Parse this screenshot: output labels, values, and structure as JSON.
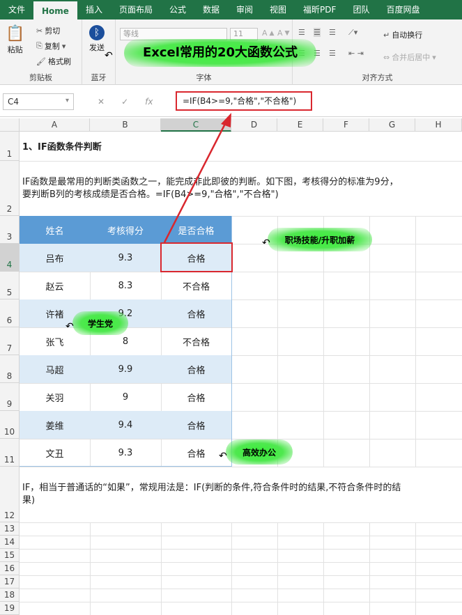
{
  "tabs": [
    "文件",
    "Home",
    "插入",
    "页面布局",
    "公式",
    "数据",
    "审阅",
    "视图",
    "福昕PDF",
    "团队",
    "百度网盘"
  ],
  "ribbon": {
    "paste": "粘贴",
    "cut": "剪切",
    "copy": "复制",
    "format_painter": "格式刷",
    "clipboard_label": "剪贴板",
    "send": "发送",
    "bluetooth_label": "蓝牙",
    "font_name": "等线",
    "font_size": "11",
    "font_label": "字体",
    "wrap": "自动换行",
    "merge": "合并后居中",
    "align_label": "对齐方式"
  },
  "banner": "Excel常用的20大函数公式",
  "formula_bar": {
    "name_box": "C4",
    "formula": "=IF(B4>=9,\"合格\",\"不合格\")"
  },
  "columns": [
    "A",
    "B",
    "C",
    "D",
    "E",
    "F",
    "G",
    "H"
  ],
  "rows": [
    "1",
    "2",
    "3",
    "4",
    "5",
    "6",
    "7",
    "8",
    "9",
    "10",
    "11",
    "12",
    "13",
    "14",
    "15",
    "16",
    "17",
    "18",
    "19"
  ],
  "sheet": {
    "title": "1、IF函数条件判断",
    "desc_line1": "IF函数是最常用的判断类函数之一，能完成非此即彼的判断。如下图，考核得分的标准为9分，",
    "desc_line2": "要判断B列的考核成绩是否合格。=IF(B4>=9,\"合格\",\"不合格\")",
    "table_headers": [
      "姓名",
      "考核得分",
      "是否合格"
    ],
    "table_rows": [
      [
        "吕布",
        "9.3",
        "合格"
      ],
      [
        "赵云",
        "8.3",
        "不合格"
      ],
      [
        "许褚",
        "9.2",
        "合格"
      ],
      [
        "张飞",
        "8",
        "不合格"
      ],
      [
        "马超",
        "9.9",
        "合格"
      ],
      [
        "关羽",
        "9",
        "合格"
      ],
      [
        "姜维",
        "9.4",
        "合格"
      ],
      [
        "文丑",
        "9.3",
        "合格"
      ]
    ],
    "note_line1": "IF，相当于普通话的“如果”，常规用法是：IF(判断的条件,符合条件时的结果,不符合条件时的结",
    "note_line2": "果)"
  },
  "stickers": [
    "职场技能/升职加薪",
    "学生党",
    "高效办公"
  ],
  "colors": {
    "accent": "#217346",
    "table_header": "#5b9bd5",
    "table_band": "#ddebf7",
    "highlight": "#d9272e"
  }
}
